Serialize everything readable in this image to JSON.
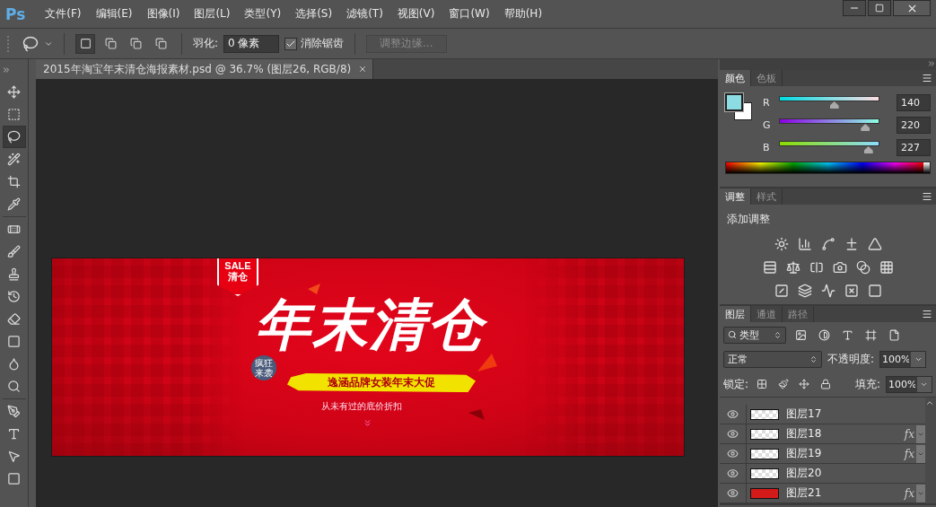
{
  "app": {
    "logo": "Ps"
  },
  "menu": [
    "文件(F)",
    "编辑(E)",
    "图像(I)",
    "图层(L)",
    "类型(Y)",
    "选择(S)",
    "滤镜(T)",
    "视图(V)",
    "窗口(W)",
    "帮助(H)"
  ],
  "options": {
    "modes": [
      {
        "selected": true
      },
      {
        "selected": false
      },
      {
        "selected": false
      },
      {
        "selected": false
      }
    ],
    "feather_label": "羽化:",
    "feather_value": "0 像素",
    "antialias": {
      "label": "消除锯齿",
      "checked": true
    },
    "refine": {
      "label": "调整边缘...",
      "disabled": true
    }
  },
  "document_tab": {
    "title": "2015年淘宝年末清仓海报素材.psd @ 36.7% (图层26, RGB/8)"
  },
  "tools": [
    {
      "selected": false
    },
    {
      "selected": false
    },
    {
      "selected": true
    },
    {
      "selected": false
    },
    {
      "selected": false
    },
    {
      "selected": false
    },
    {
      "selected": false
    },
    {
      "selected": false
    },
    {
      "selected": false
    },
    {
      "selected": false
    },
    {
      "selected": false
    },
    {
      "selected": false
    },
    {
      "selected": false
    },
    {
      "selected": false
    },
    {
      "selected": false
    },
    {
      "selected": false
    },
    {
      "selected": false
    },
    {
      "selected": false
    }
  ],
  "poster": {
    "sale_tag": {
      "top": "SALE",
      "bottom": "清仓"
    },
    "title": "年末清仓",
    "hang_tag": "疯狂来袭",
    "banner": "逸涵品牌女装年末大促",
    "subtitle": "从未有过的底价折扣"
  },
  "color_panel": {
    "tabs": [
      {
        "label": "颜色",
        "selected": true
      },
      {
        "label": "色板",
        "selected": false
      }
    ],
    "foreground": {
      "color": "#8cdce3"
    },
    "background": {
      "color": "#ffffff"
    },
    "channels": [
      {
        "name": "R",
        "level": 0.55,
        "value": "140"
      },
      {
        "name": "G",
        "level": 0.86,
        "value": "220"
      },
      {
        "name": "B",
        "level": 0.89,
        "value": "227"
      }
    ]
  },
  "adjustments_panel": {
    "tabs": [
      {
        "label": "调整",
        "selected": true
      },
      {
        "label": "样式",
        "selected": false
      }
    ],
    "heading": "添加调整"
  },
  "layers_panel": {
    "tabs": [
      {
        "label": "图层",
        "selected": true
      },
      {
        "label": "通道",
        "selected": false
      },
      {
        "label": "路径",
        "selected": false
      }
    ],
    "filter": "类型",
    "blend_mode": "正常",
    "opacity_label": "不透明度:",
    "opacity": "100%",
    "lock_label": "锁定:",
    "fill_label": "填充:",
    "fill": "100%",
    "layers": [
      {
        "name": "图层17",
        "visible": true
      },
      {
        "name": "图层18",
        "visible": true,
        "fx": "fx"
      },
      {
        "name": "图层19",
        "visible": true,
        "fx": "fx"
      },
      {
        "name": "图层20",
        "visible": true
      },
      {
        "name": "图层21",
        "visible": true,
        "fx": "fx",
        "color": "#d51a1a"
      }
    ]
  }
}
